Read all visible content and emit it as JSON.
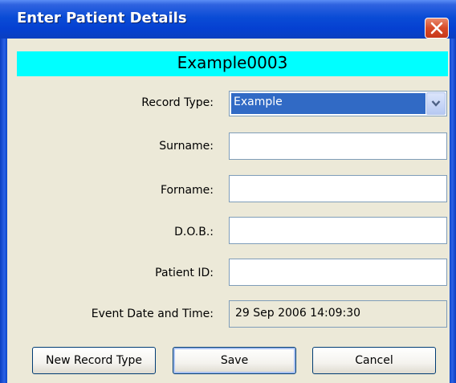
{
  "window": {
    "title": "Enter Patient Details"
  },
  "record": {
    "id": "Example0003"
  },
  "form": {
    "record_type": {
      "label": "Record Type:",
      "value": "Example"
    },
    "surname": {
      "label": "Surname:",
      "value": ""
    },
    "forname": {
      "label": "Forname:",
      "value": ""
    },
    "dob": {
      "label": "D.O.B.:",
      "value": ""
    },
    "patient_id": {
      "label": "Patient ID:",
      "value": ""
    },
    "event_datetime": {
      "label": "Event Date and Time:",
      "value": "29 Sep 2006 14:09:30"
    }
  },
  "buttons": {
    "new_record_type": "New Record Type",
    "save": "Save",
    "cancel": "Cancel"
  },
  "icons": {
    "close": "close-icon",
    "dropdown": "chevron-down-icon"
  },
  "colors": {
    "titlebar": "#0540d1",
    "banner": "#00ffff",
    "selection": "#316ac5",
    "close": "#d74a28"
  }
}
